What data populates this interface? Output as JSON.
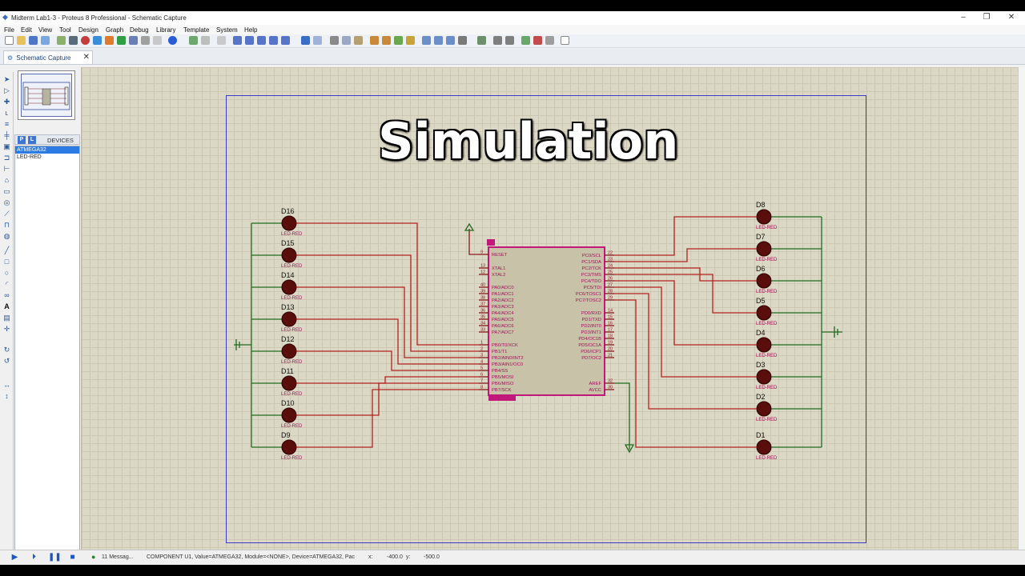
{
  "window": {
    "title": "Midterm Lab1-3 - Proteus 8 Professional - Schematic Capture",
    "minimize": "–",
    "maximize": "❐",
    "close": "✕"
  },
  "menu": [
    "File",
    "Edit",
    "View",
    "Tool",
    "Design",
    "Graph",
    "Debug",
    "Library",
    "Template",
    "System",
    "Help"
  ],
  "tab": {
    "label": "Schematic Capture",
    "close": "✕"
  },
  "devices": {
    "p_button": "P",
    "l_button": "L",
    "title": "DEVICES",
    "items": [
      "ATMEGA32",
      "LED-RED"
    ],
    "selected": "ATMEGA32"
  },
  "overlay_title": "Simulation",
  "schematic": {
    "mcu_ref": "U1",
    "mcu_left_pins": [
      {
        "num": "9",
        "name": "RESET"
      },
      {
        "num": "13",
        "name": "XTAL1"
      },
      {
        "num": "12",
        "name": "XTAL2"
      },
      {
        "num": "40",
        "name": "PA0/ADC0"
      },
      {
        "num": "39",
        "name": "PA1/ADC1"
      },
      {
        "num": "38",
        "name": "PA2/ADC2"
      },
      {
        "num": "37",
        "name": "PA3/ADC3"
      },
      {
        "num": "36",
        "name": "PA4/ADC4"
      },
      {
        "num": "35",
        "name": "PA5/ADC5"
      },
      {
        "num": "34",
        "name": "PA6/ADC6"
      },
      {
        "num": "33",
        "name": "PA7/ADC7"
      },
      {
        "num": "1",
        "name": "PB0/T0/XCK"
      },
      {
        "num": "2",
        "name": "PB1/T1"
      },
      {
        "num": "3",
        "name": "PB2/AIN0/INT2"
      },
      {
        "num": "4",
        "name": "PB3/AIN1/OC0"
      },
      {
        "num": "5",
        "name": "PB4/SS"
      },
      {
        "num": "6",
        "name": "PB5/MOSI"
      },
      {
        "num": "7",
        "name": "PB6/MISO"
      },
      {
        "num": "8",
        "name": "PB7/SCK"
      }
    ],
    "mcu_right_pins": [
      {
        "num": "22",
        "name": "PC0/SCL"
      },
      {
        "num": "23",
        "name": "PC1/SDA"
      },
      {
        "num": "24",
        "name": "PC2/TCK"
      },
      {
        "num": "25",
        "name": "PC3/TMS"
      },
      {
        "num": "26",
        "name": "PC4/TDO"
      },
      {
        "num": "27",
        "name": "PC5/TDI"
      },
      {
        "num": "28",
        "name": "PC6/TOSC1"
      },
      {
        "num": "29",
        "name": "PC7/TOSC2"
      },
      {
        "num": "14",
        "name": "PD0/RXD"
      },
      {
        "num": "15",
        "name": "PD1/TXD"
      },
      {
        "num": "16",
        "name": "PD2/INT0"
      },
      {
        "num": "17",
        "name": "PD3/INT1"
      },
      {
        "num": "18",
        "name": "PD4/OC1B"
      },
      {
        "num": "19",
        "name": "PD5/OC1A"
      },
      {
        "num": "20",
        "name": "PD6/ICP1"
      },
      {
        "num": "21",
        "name": "PD7/OC2"
      },
      {
        "num": "32",
        "name": "AREF"
      },
      {
        "num": "30",
        "name": "AVCC"
      }
    ],
    "left_leds": [
      "D16",
      "D15",
      "D14",
      "D13",
      "D12",
      "D11",
      "D10",
      "D9"
    ],
    "right_leds": [
      "D8",
      "D7",
      "D6",
      "D5",
      "D4",
      "D3",
      "D2",
      "D1"
    ],
    "led_type": "LED-RED"
  },
  "status": {
    "messages": "11 Messag...",
    "info": "COMPONENT U1, Value=ATMEGA32, Module=<NONE>, Device=ATMEGA32, Pac",
    "x_label": "x:",
    "x_value": "-400.0",
    "y_label": "y:",
    "y_value": "-500.0"
  },
  "colors": {
    "wire": "#b22222",
    "ground_wire": "#1f6b1f",
    "chip_fill": "#c8c3a8",
    "chip_border": "#c2187a",
    "sheet_border": "#3c3cc8",
    "led": "#5a0d0d"
  }
}
